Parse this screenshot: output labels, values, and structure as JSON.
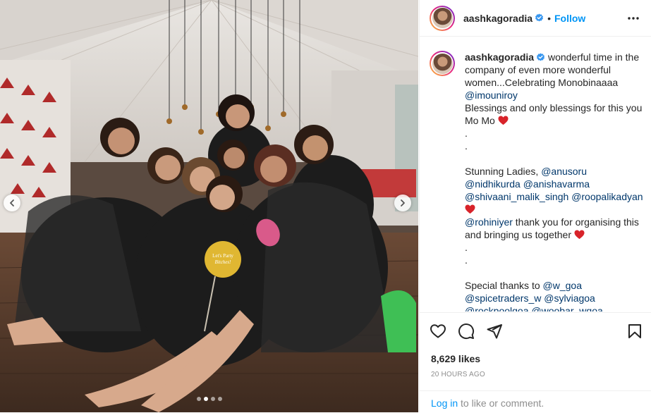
{
  "post": {
    "username": "aashkagoradia",
    "follow_label": "Follow",
    "separator": "•",
    "likes": "8,629 likes",
    "timestamp": "20 HOURS AGO",
    "caption": {
      "line1": "wonderful time in the company of even more wonderful women...Celebrating Monobinaaaa",
      "mention_mouni": "@imouniroy",
      "line2": "Blessings and only blessings for this you Mo Mo",
      "dot1": ".",
      "dot2": ".",
      "stunning_label": "Stunning Ladies,",
      "m1": "@anusoru",
      "m2": "@nidhikurda",
      "m3": "@anishavarma",
      "m4": "@shivaani_malik_singh",
      "m5": "@roopalikadyan",
      "m6": "@rohiniyer",
      "thanks_text": "thank you for organising this and bringing us together",
      "dot3": ".",
      "dot4": ".",
      "special_label": "Special thanks to",
      "m7": "@w_goa",
      "m8": "@spicetraders_w",
      "m9": "@sylviagoa",
      "m10": "@rockpoolgoa",
      "m11": "@woobar_wgoa"
    }
  },
  "photo": {
    "prop_sign_text": "Let's Party Bitches!",
    "carousel_dots": 4,
    "active_dot": 1
  },
  "login": {
    "link_label": "Log in",
    "rest": "to like or comment."
  },
  "colors": {
    "follow_blue": "#0095f6",
    "mention_blue": "#00376b",
    "heart_red": "#ed4956",
    "muted_gray": "#8e8e8e"
  },
  "icons": [
    "verified-badge-icon",
    "more-options-icon",
    "heart-icon",
    "comment-icon",
    "share-icon",
    "save-icon",
    "chevron-left-icon",
    "chevron-right-icon"
  ]
}
